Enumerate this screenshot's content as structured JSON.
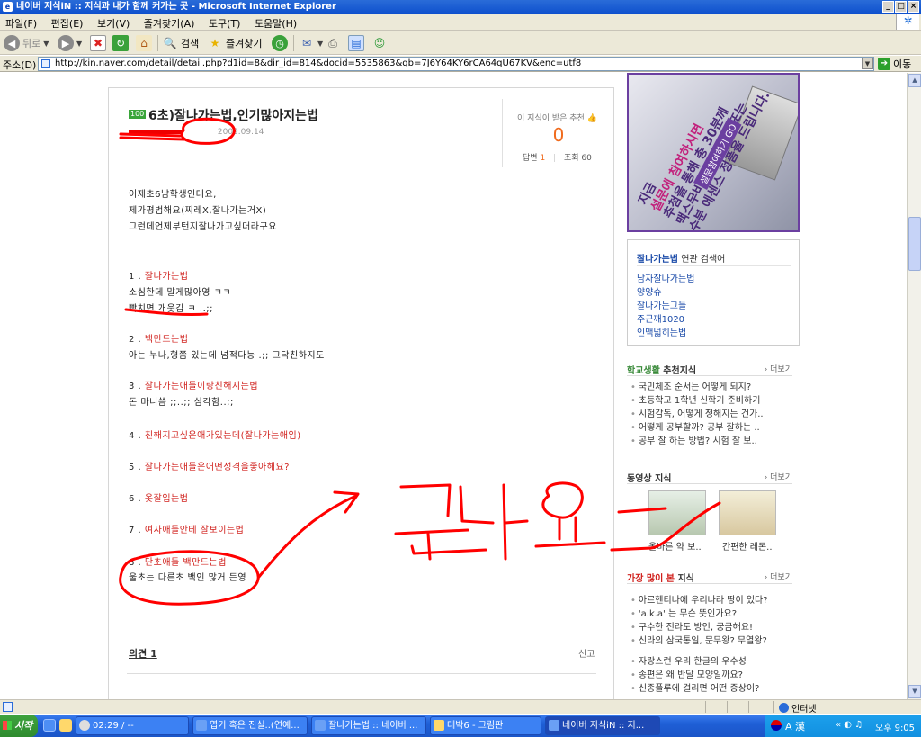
{
  "window": {
    "title": "네이버 지식iN :: 지식과 내가 함께 커가는 곳 - Microsoft Internet Explorer",
    "app_icon": "e",
    "controls": [
      "_",
      "□",
      "×"
    ]
  },
  "menu": [
    "파일(F)",
    "편집(E)",
    "보기(V)",
    "즐겨찾기(A)",
    "도구(T)",
    "도움말(H)"
  ],
  "toolbar": {
    "back": "뒤로",
    "search": "검색",
    "favorites": "즐겨찾기"
  },
  "address": {
    "label": "주소(D)",
    "url": "http://kin.naver.com/detail/detail.php?d1id=8&dir_id=814&docid=5535863&qb=7J6Y64KY6rCA64qU67KV&enc=utf8",
    "go_label": "이동"
  },
  "page": {
    "question": {
      "badge": "100",
      "title": "6초)잘나가는법,인기많아지는법",
      "date": "2009.09.14",
      "recommend_label": "이 지식이 받은 추천",
      "recommend_count": "0",
      "answers_label": "답변",
      "answers_count": "1",
      "views_label": "조회",
      "views_count": "60",
      "intro": [
        "이제초6남학생인데요,",
        "제가평범해요(찌레X,잘나가는거X)",
        "그런데언제부턴지잘나가고싶더라구요"
      ],
      "items": [
        {
          "num": "1 .",
          "head": "잘나가는법",
          "lines": [
            "소심한데 말게많아영 ㅋㅋ",
            "빡치면 개웃김 ㅋ ..;;"
          ]
        },
        {
          "num": "2 .",
          "head": "백만드는법",
          "lines": [
            "아는 누나,형쯤 있는데 넘적다능 .;; 그닥친하지도"
          ]
        },
        {
          "num": "3 .",
          "head": "잘나가는애들이랑친해지는법",
          "lines": [
            "돈 마니씀 ;;..;; 심각함..;;"
          ]
        },
        {
          "num": "4 .",
          "head": "친해지고싶은애가있는데(잘나가는애임)",
          "lines": []
        },
        {
          "num": "5 .",
          "head": "잘나가는애들은어떤성격을좋아해요?",
          "lines": []
        },
        {
          "num": "6 .",
          "head": "옷잘입는법",
          "lines": []
        },
        {
          "num": "7 .",
          "head": "여자애들안테 잘보이는법",
          "lines": []
        },
        {
          "num": "8 .",
          "head": "단초애들 백만드는법",
          "lines": [
            "울초는 다른초 백인 많거 든영"
          ]
        }
      ],
      "comment_label": "의견 1",
      "report_label": "신고"
    },
    "ad": {
      "lines": [
        "지금",
        "설문에 참여하시면",
        "추첨을 통해 총 30분께",
        "맥스무비 영화예매권 또는",
        "수분 에센스 정품을 드립니다."
      ],
      "button": "설문참여하기 GO"
    },
    "related": {
      "keyword": "잘나가는법",
      "suffix": "연관 검색어",
      "items": [
        "남자잘나가는법",
        "양양슈",
        "잘나가는그들",
        "주근깨1020",
        "인맥넓히는법"
      ]
    },
    "school": {
      "title_accent": "학교생활",
      "title_rest": "추천지식",
      "more": "더보기",
      "items": [
        "국민체조 순서는 어떻게 되지?",
        "초등학교 1학년 신학기 준비하기",
        "시험감독, 어떻게 정해지는 건가..",
        "어떻게 공부할까? 공부 잘하는 ..",
        "공부 잘 하는 방법? 시험 잘 보.."
      ]
    },
    "video": {
      "title": "동영상 지식",
      "more": "더보기",
      "items": [
        "올바른 약 보..",
        "간편한 레몬.."
      ]
    },
    "popular": {
      "title_accent": "가장 많이 본",
      "title_rest": "지식",
      "more": "더보기",
      "items": [
        "아르헨티나에 우리나라 땅이 있다?",
        "'a.k.a' 는 무슨 뜻인가요?",
        "구수한 전라도 방언, 궁금해요!",
        "신라의 삼국통일, 문무왕? 무열왕?",
        "자랑스런 우리 한글의 우수성",
        "송편은 왜 반달 모양일까요?",
        "신종플루에 걸리면 어떤 증상이?"
      ]
    }
  },
  "status": {
    "zone": "인터넷"
  },
  "taskbar": {
    "start": "시작",
    "tasks": [
      "02:29 / --",
      "엽기 혹은 진실..(연예...",
      "잘나가는법 :: 네이버 ...",
      "대박6 - 그림판",
      "네이버 지식iN :: 지..."
    ],
    "ime": "A 漢",
    "clock": "오후 9:05"
  },
  "colors": {
    "accent_red": "#d0201c",
    "link_blue": "#1a4aa8",
    "recommend_orange": "#f06a1c",
    "scribble_red": "#ff0000",
    "ad_purple": "#6b3fa0"
  }
}
